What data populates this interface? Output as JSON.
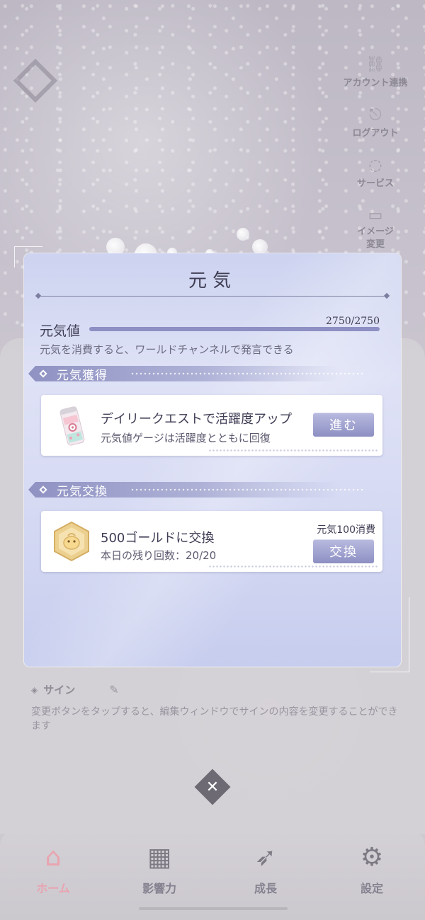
{
  "side_menu": {
    "items": [
      {
        "label": "アカウント連携",
        "icon": "link-icon"
      },
      {
        "label": "ログアウト",
        "icon": "logout-icon"
      },
      {
        "label": "サービス",
        "icon": "service-icon"
      },
      {
        "label": "イメージ\n変更",
        "icon": "image-icon"
      }
    ]
  },
  "profile": {
    "sign_title": "サイン",
    "sign_desc": "変更ボタンをタップすると、編集ウィンドウでサインの内容を変更することができます"
  },
  "modal": {
    "title": "元気",
    "genki": {
      "label": "元気値",
      "value_text": "2750/2750",
      "current": 2750,
      "max": 2750,
      "description": "元気を消費すると、ワールドチャンネルで発言できる"
    },
    "acquire_section": {
      "title": "元気獲得",
      "card": {
        "title": "デイリークエストで活躍度アップ",
        "subtitle": "元気値ゲージは活躍度とともに回復",
        "button": "進む",
        "icon": "energy-drink-can-icon"
      }
    },
    "exchange_section": {
      "title": "元気交換",
      "card": {
        "title": "500ゴールドに交換",
        "subtitle": "本日の残り回数：20/20",
        "cost": "元気100消費",
        "button": "交換",
        "icon": "gold-coin-icon"
      }
    }
  },
  "close_label": "✕",
  "bottom_nav": {
    "items": [
      {
        "label": "ホーム",
        "icon": "home-icon",
        "active": true
      },
      {
        "label": "影響力",
        "icon": "grid-icon",
        "active": false
      },
      {
        "label": "成長",
        "icon": "rocket-icon",
        "active": false
      },
      {
        "label": "設定",
        "icon": "gear-icon",
        "active": false
      }
    ]
  },
  "colors": {
    "accent": "#8e8fc3",
    "active_nav": "#e9a4b0",
    "modal_bg": "#dfe2f6"
  }
}
